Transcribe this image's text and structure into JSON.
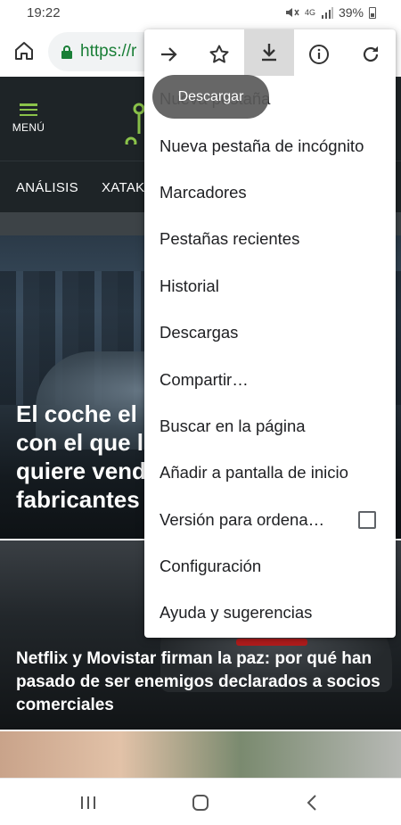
{
  "status_bar": {
    "time": "19:22",
    "network": "4G",
    "battery": "39%"
  },
  "browser": {
    "url": "https://r"
  },
  "site": {
    "menu_label": "MENÚ",
    "nav": [
      "ANÁLISIS",
      "XATAK"
    ]
  },
  "articles": [
    {
      "title": "El coche el\ncon el que l\nquiere vend\nfabricantes"
    },
    {
      "title": "Netflix y Movistar firman la paz: por qué han pasado de ser enemigos declarados a socios comerciales"
    }
  ],
  "overflow_menu": {
    "icons": [
      "forward-icon",
      "star-icon",
      "download-icon",
      "info-icon",
      "refresh-icon"
    ],
    "tooltip": "Descargar",
    "items": [
      "Nueva pestaña",
      "Nueva pestaña de incógnito",
      "Marcadores",
      "Pestañas recientes",
      "Historial",
      "Descargas",
      "Compartir…",
      "Buscar en la página",
      "Añadir a pantalla de inicio",
      "Versión para ordena…",
      "Configuración",
      "Ayuda y sugerencias"
    ]
  },
  "colors": {
    "site_bg": "#1e2427",
    "accent": "#8bc34a",
    "url_green": "#1a7f37"
  }
}
